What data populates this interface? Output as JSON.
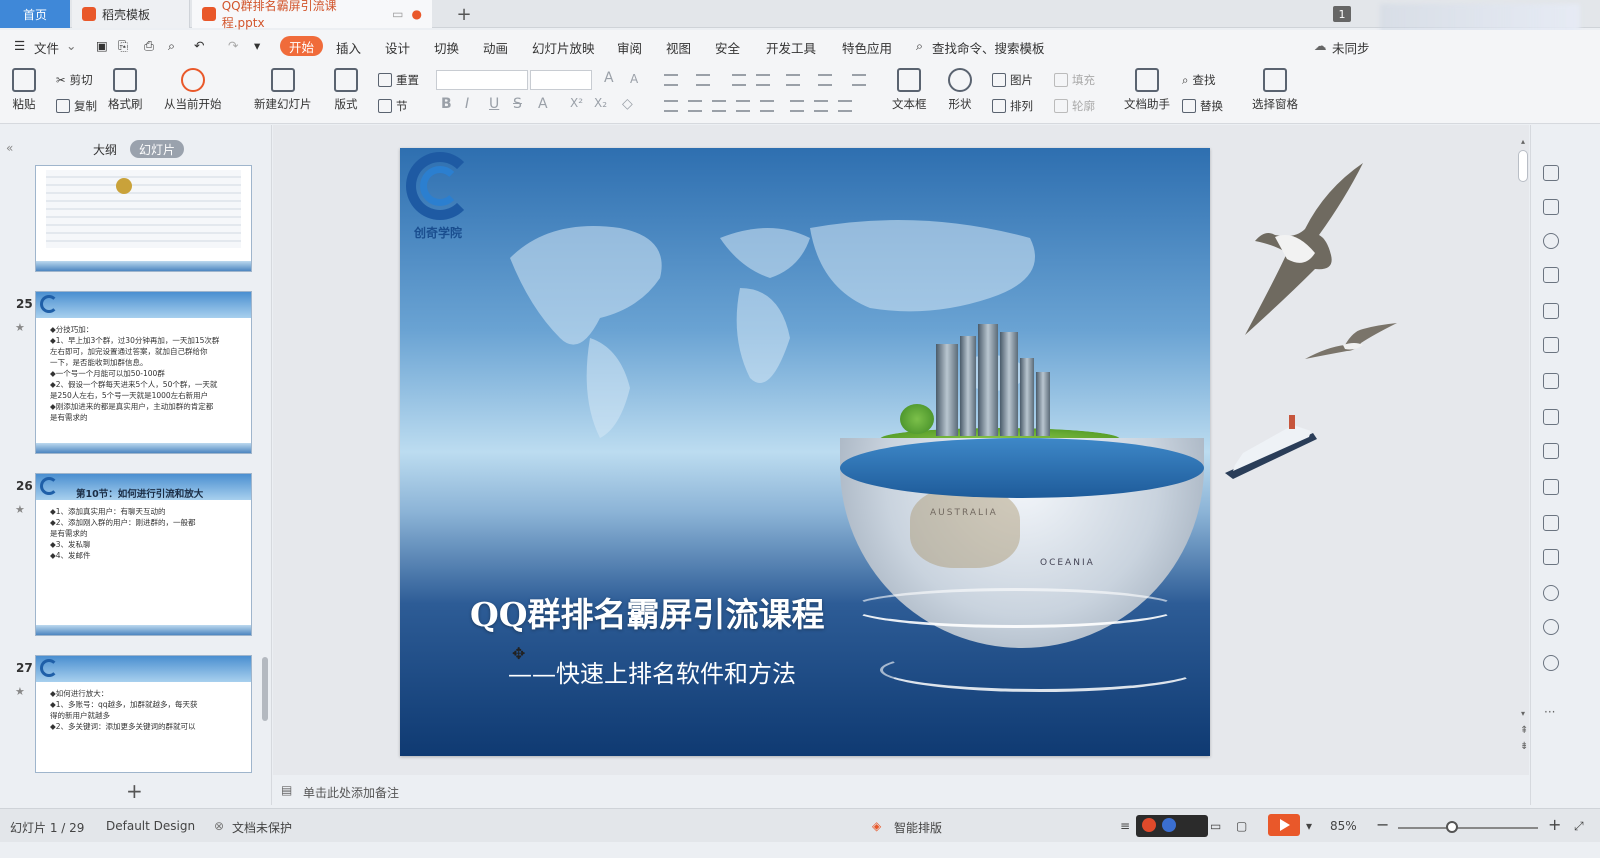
{
  "tabs": {
    "home": "首页",
    "template": "稻壳模板",
    "document": "QQ群排名霸屏引流课程.pptx",
    "page_badge": "1"
  },
  "menu": {
    "file": "文件",
    "items": [
      "开始",
      "插入",
      "设计",
      "切换",
      "动画",
      "幻灯片放映",
      "审阅",
      "视图",
      "安全",
      "开发工具",
      "特色应用"
    ],
    "search": "查找命令、搜索模板",
    "sync": "未同步"
  },
  "ribbon": {
    "paste": "粘贴",
    "cut": "剪切",
    "copy": "复制",
    "format_painter": "格式刷",
    "from_current": "从当前开始",
    "new_slide": "新建幻灯片",
    "layout": "版式",
    "reset": "重置",
    "section": "节",
    "textbox": "文本框",
    "shape": "形状",
    "picture": "图片",
    "fill": "填充",
    "arrange": "排列",
    "outline": "轮廓",
    "doc_helper": "文档助手",
    "find": "查找",
    "replace": "替换",
    "select_pane": "选择窗格"
  },
  "left_panel": {
    "outline_tab": "大纲",
    "slides_tab": "幻灯片",
    "slides": [
      {
        "num": "25",
        "lines": [
          "◆分技巧加：",
          "◆1、早上加3个群，过30分钟再加，一天加15次群",
          "左右即可，加完设置通过答案，就加自己群给你",
          "一下，是否能收到加群信息。",
          "◆一个号一个月能可以加50-100群",
          "◆2、假设一个群每天进来5个人，50个群，一天就",
          "是250人左右，5个号一天就是1000左右新用户",
          "◆刚添加进来的都是真实用户，主动加群的肯定都",
          "是有需求的"
        ]
      },
      {
        "num": "26",
        "title": "第10节：如何进行引流和放大",
        "lines": [
          "◆1、添加真实用户：有聊天互动的",
          "◆2、添加刚入群的用户：刚进群的，一般都",
          "是有需求的",
          "◆3、发私聊",
          "◆4、发邮件"
        ]
      },
      {
        "num": "27",
        "lines": [
          "◆如何进行放大：",
          "◆1、多账号：qq越多，加群就越多，每天获",
          "得的新用户就越多",
          "◆2、多关键词：添加更多关键词的群就可以"
        ]
      }
    ],
    "add_label": "+"
  },
  "slide": {
    "logo_text": "创奇学院",
    "title": "QQ群排名霸屏引流课程",
    "subtitle": "——快速上排名软件和方法",
    "globe_label_1": "AUSTRALIA",
    "globe_label_2": "OCEANIA"
  },
  "notes": {
    "placeholder": "单击此处添加备注"
  },
  "status": {
    "slide_pos": "幻灯片 1 / 29",
    "theme": "Default Design",
    "protect": "文档未保护",
    "smart": "智能排版",
    "zoom": "85%"
  }
}
